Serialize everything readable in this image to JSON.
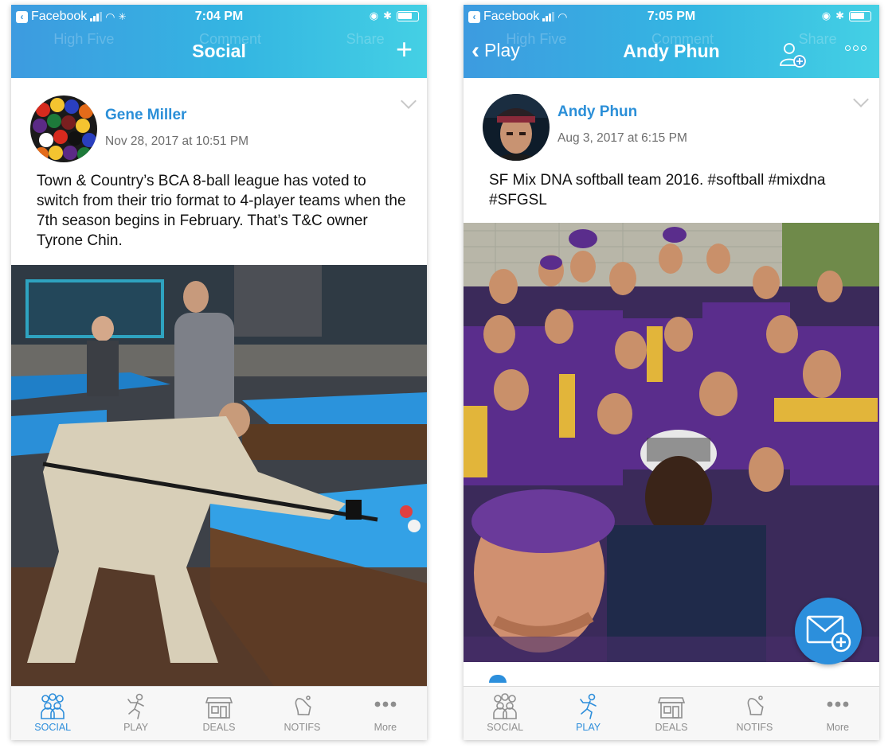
{
  "screens": [
    {
      "status": {
        "carrier": "Facebook",
        "time": "7:04 PM"
      },
      "ghost_actions": [
        "High Five",
        "Comment",
        "Share"
      ],
      "nav": {
        "title": "Social"
      },
      "post": {
        "author": "Gene Miller",
        "date": "Nov 28, 2017 at 10:51 PM",
        "text": "Town & Country’s BCA 8-ball league has voted to switch from their trio format to 4-player teams when the 7th season begins in February. That’s T&C owner Tyrone Chin."
      },
      "tabs": [
        {
          "label": "SOCIAL",
          "icon": "people-icon",
          "active": true
        },
        {
          "label": "PLAY",
          "icon": "runner-icon",
          "active": false
        },
        {
          "label": "DEALS",
          "icon": "storefront-icon",
          "active": false
        },
        {
          "label": "NOTIFS",
          "icon": "bell-icon",
          "active": false
        },
        {
          "label": "More",
          "icon": "more-icon",
          "active": false
        }
      ]
    },
    {
      "status": {
        "carrier": "Facebook",
        "time": "7:05 PM"
      },
      "ghost_actions": [
        "High Five",
        "Comment",
        "Share"
      ],
      "nav": {
        "back": "Play",
        "title": "Andy Phun"
      },
      "post": {
        "author": "Andy Phun",
        "date": "Aug 3, 2017 at 6:15 PM",
        "text": "SF Mix DNA softball team 2016. #softball #mixdna #SFGSL"
      },
      "tabs": [
        {
          "label": "SOCIAL",
          "icon": "people-icon",
          "active": false
        },
        {
          "label": "PLAY",
          "icon": "runner-icon",
          "active": true
        },
        {
          "label": "DEALS",
          "icon": "storefront-icon",
          "active": false
        },
        {
          "label": "NOTIFS",
          "icon": "bell-icon",
          "active": false
        },
        {
          "label": "More",
          "icon": "more-icon",
          "active": false
        }
      ]
    }
  ],
  "colors": {
    "accent": "#2d8edb",
    "header_start": "#3d9be0",
    "header_end": "#44d0e4",
    "tab_inactive": "#8e8e8e"
  }
}
